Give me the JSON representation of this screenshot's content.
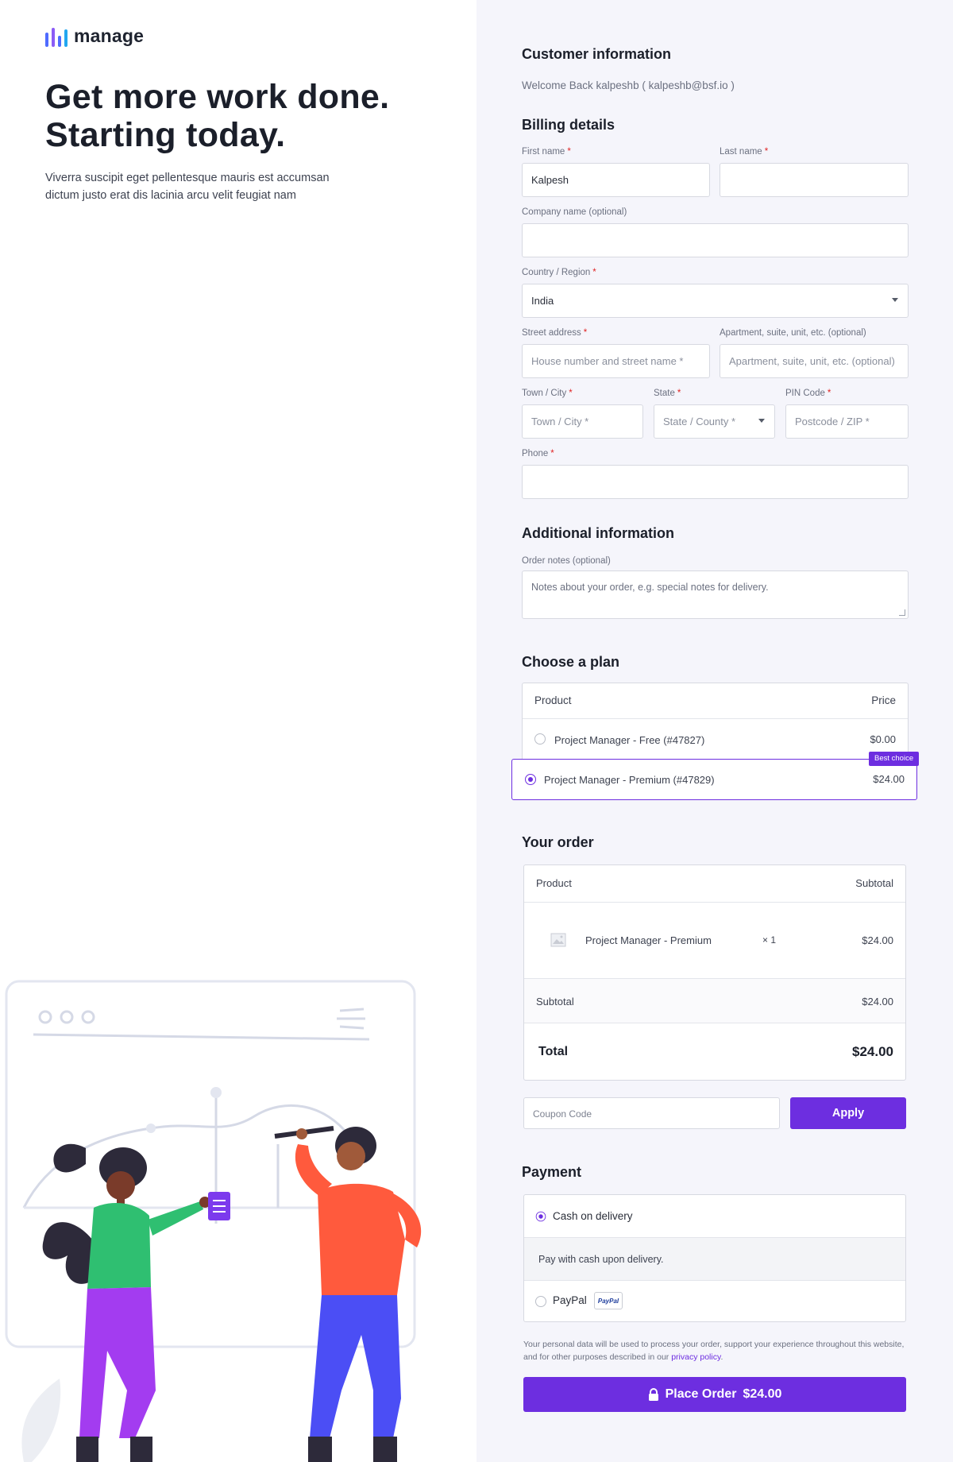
{
  "brand": {
    "name": "manage",
    "colors": [
      "#4f6bff",
      "#8b5cf6",
      "#22a7f0"
    ]
  },
  "hero": {
    "title_line1": "Get more work done.",
    "title_line2": "Starting today.",
    "subtitle": "Viverra suscipit eget pellentesque mauris est accumsan dictum justo erat dis lacinia arcu velit feugiat nam"
  },
  "customer": {
    "title": "Customer information",
    "welcome": "Welcome Back kalpeshb ( kalpeshb@bsf.io )"
  },
  "billing": {
    "title": "Billing details",
    "required_mark": "*",
    "first_name": {
      "label": "First name",
      "value": "Kalpesh"
    },
    "last_name": {
      "label": "Last name",
      "value": ""
    },
    "company": {
      "label": "Company name (optional)",
      "value": ""
    },
    "country": {
      "label": "Country / Region",
      "value": "India"
    },
    "street": {
      "label": "Street address",
      "placeholder": "House number and street name *"
    },
    "apartment": {
      "label": "Apartment, suite, unit, etc. (optional)",
      "placeholder": "Apartment, suite, unit, etc. (optional)"
    },
    "city": {
      "label": "Town / City",
      "placeholder": "Town / City *"
    },
    "state": {
      "label": "State",
      "placeholder": "State / County *"
    },
    "pin": {
      "label": "PIN Code",
      "placeholder": "Postcode / ZIP *"
    },
    "phone": {
      "label": "Phone",
      "value": ""
    }
  },
  "additional": {
    "title": "Additional information",
    "notes_label": "Order notes (optional)",
    "notes_placeholder": "Notes about your order, e.g. special notes for delivery."
  },
  "plan": {
    "title": "Choose a plan",
    "col_product": "Product",
    "col_price": "Price",
    "options": [
      {
        "name": "Project Manager - Free (#47827)",
        "price": "$0.00",
        "selected": false
      },
      {
        "name": "Project Manager - Premium (#47829)",
        "price": "$24.00",
        "selected": true
      }
    ],
    "badge": "Best choice"
  },
  "order": {
    "title": "Your order",
    "col_product": "Product",
    "col_subtotal": "Subtotal",
    "item_name": "Project Manager - Premium",
    "item_qty": "× 1",
    "item_price": "$24.00",
    "subtotal_label": "Subtotal",
    "subtotal_value": "$24.00",
    "total_label": "Total",
    "total_value": "$24.00"
  },
  "coupon": {
    "placeholder": "Coupon Code",
    "apply_label": "Apply"
  },
  "payment": {
    "title": "Payment",
    "cod_label": "Cash on delivery",
    "cod_desc": "Pay with cash upon delivery.",
    "paypal_label": "PayPal",
    "paypal_logo": "PayPal",
    "selected": "cod"
  },
  "privacy": {
    "text": "Your personal data will be used to process your order, support your experience throughout this website, and for other purposes described in our",
    "link": "privacy policy",
    "end": "."
  },
  "place_order": {
    "label": "Place Order",
    "amount": "$24.00"
  },
  "accent_color": "#6d2ee0"
}
